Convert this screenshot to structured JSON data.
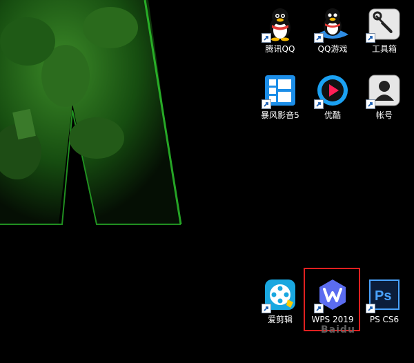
{
  "desktop": {
    "icons": [
      {
        "label": "腾讯QQ",
        "icon": "qq-penguin-icon"
      },
      {
        "label": "QQ游戏",
        "icon": "qq-game-penguin-icon"
      },
      {
        "label": "工具箱",
        "icon": "toolbox-wrench-icon"
      },
      {
        "label": "暴风影音5",
        "icon": "baofeng-player-icon"
      },
      {
        "label": "优酷",
        "icon": "youku-play-icon"
      },
      {
        "label": "帐号",
        "icon": "account-user-icon"
      },
      {
        "label": "爱剪辑",
        "icon": "aijianji-film-icon"
      },
      {
        "label": "WPS 2019",
        "icon": "wps-icon"
      },
      {
        "label": "PS CS6",
        "icon": "photoshop-icon"
      }
    ],
    "selection_highlight_color": "#e02020",
    "watermark": "Baidu"
  }
}
